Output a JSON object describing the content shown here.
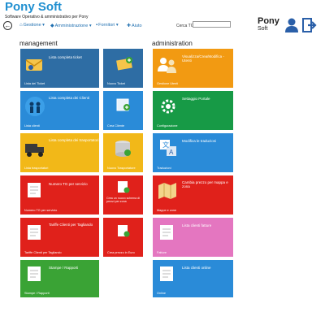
{
  "app": {
    "title": "Pony Soft",
    "subtitle": "Software Operativo & amministrativo per Pony"
  },
  "menu": [
    {
      "label": "Gestione",
      "caret": "▾"
    },
    {
      "label": "Amministrazione",
      "caret": "▾"
    },
    {
      "label": "Fornitori",
      "caret": "▾"
    },
    {
      "label": "Aiuto",
      "caret": ""
    }
  ],
  "search": {
    "label": "Cerca TG",
    "value": "",
    "placeholder": ""
  },
  "brand": {
    "name": "Pony",
    "sub": "Soft"
  },
  "sections": {
    "management": "management",
    "administration": "administration"
  },
  "tiles": {
    "ticket_list": {
      "label": "Lista completa ticket",
      "footer": "Lista dei Ticket",
      "color": "#2e6da4"
    },
    "new_ticket": {
      "label": "",
      "footer": "Nuovo Ticket",
      "color": "#2e6da4"
    },
    "client_list": {
      "label": "Lista completa dei Clienti",
      "footer": "Lista clienti",
      "color": "#2a8bd8"
    },
    "new_client": {
      "label": "",
      "footer": "Crea Cliente",
      "color": "#2a8bd8"
    },
    "shipment_list": {
      "label": "Lista completa dei trasportatori",
      "footer": "Lista trasportatori",
      "color": "#f2b818"
    },
    "new_shipper": {
      "label": "",
      "footer": "Nuovo Trasportatore",
      "color": "#f2b818"
    },
    "tg_number": {
      "label": "Numero TG per servizio",
      "footer": "Numero TG per servizio",
      "color": "#e0211b"
    },
    "new_price_scheme": {
      "label": "Crea un nuovo schema di prezzi per zona",
      "footer": "",
      "color": "#e0211b"
    },
    "client_rates": {
      "label": "Tariffe Clienti per Tagliando",
      "footer": "Tariffe Clienti per Tagliando",
      "color": "#e0211b"
    },
    "new_rate": {
      "label": "",
      "footer": "Crea prezzo in Euro",
      "color": "#e0211b"
    },
    "print_reports": {
      "label": "Stampe / Rapporti",
      "footer": "Stampe / Rapporti",
      "color": "#3aa335"
    },
    "user_admin": {
      "label": "Visualizza/Crea/Modifica - Utenti",
      "footer": "Gestione Utenti",
      "color": "#f29a12"
    },
    "portal_settings": {
      "label": "Settaggio Portale",
      "footer": "Configurazione",
      "color": "#179a46"
    },
    "translations": {
      "label": "Modifica le traduzioni",
      "footer": "Traduzioni",
      "color": "#2a8bd8"
    },
    "zone_prices": {
      "label": "Cambia prezzo per mappa e zona",
      "footer": "Mappe e zone",
      "color": "#e0211b"
    },
    "client_invoices": {
      "label": "Lista clienti fatture",
      "footer": "Fatture",
      "color": "#e476c0"
    },
    "online_clients": {
      "label": "Lista clienti online",
      "footer": "Online",
      "color": "#2a8bd8"
    }
  }
}
